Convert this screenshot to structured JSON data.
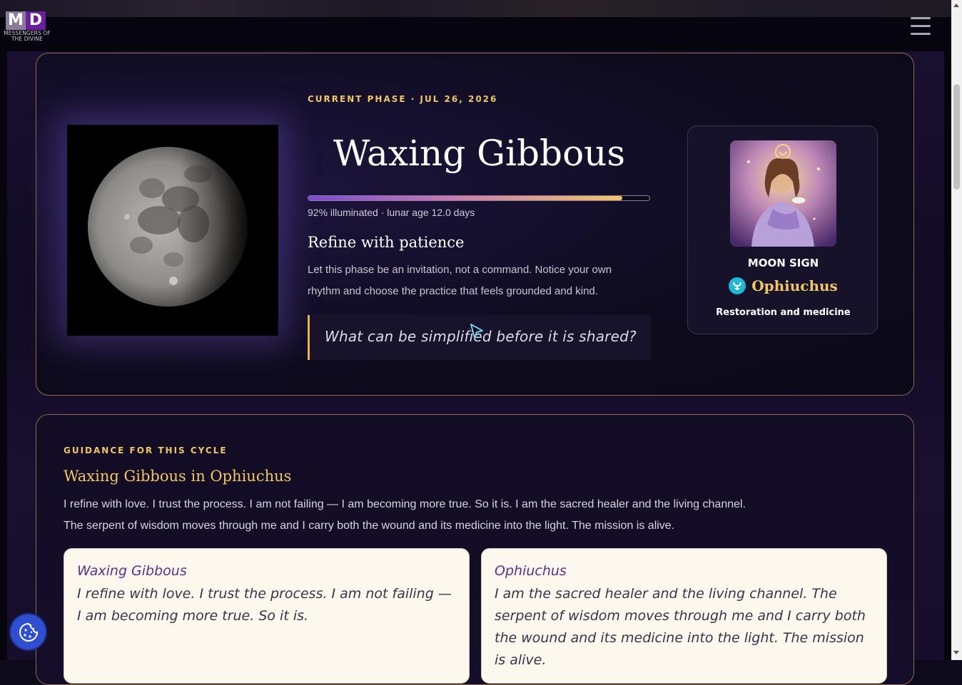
{
  "header": {
    "logo_letters": [
      "M",
      "D"
    ],
    "logo_text": "MESSENGERS OF THE DIVINE",
    "menu_icon": "hamburger-menu-icon"
  },
  "hero": {
    "eyebrow": "CURRENT PHASE · JUL 26, 2026",
    "phase_name": "Waxing Gibbous",
    "illumination_fraction": 0.92,
    "illumination_text": "92% illuminated · lunar age 12.0 days",
    "intention_title": "Refine with patience",
    "intention_text": "Let this phase be an invitation, not a command. Notice your own rhythm and choose the practice that feels grounded and kind.",
    "question": "What can be simplified before it is shared?"
  },
  "moon_sign": {
    "label": "MOON SIGN",
    "name": "Ophiuchus",
    "theme": "Restoration and medicine",
    "badge_color": "#23b8d8"
  },
  "guidance": {
    "eyebrow": "GUIDANCE FOR THIS CYCLE",
    "title": "Waxing Gibbous in Ophiuchus",
    "text_line1": "I refine with love. I trust the process. I am not failing — I am becoming more true. So it is. I am the sacred healer and the living channel.",
    "text_line2": "The serpent of wisdom moves through me and I carry both the wound and its medicine into the light. The mission is alive.",
    "cards": [
      {
        "title": "Waxing Gibbous",
        "text": "I refine with love. I trust the process. I am not failing — I am becoming more true. So it is."
      },
      {
        "title": "Ophiuchus",
        "text": "I am the sacred healer and the living channel. The serpent of wisdom moves through me and I carry both the wound and its medicine into the light. The mission is alive."
      }
    ]
  },
  "colors": {
    "accent_gold": "#f2c661",
    "accent_purple": "#5b2d8c",
    "card_border": "#8a6a4a"
  },
  "cookie_button_icon": "cookie-icon"
}
